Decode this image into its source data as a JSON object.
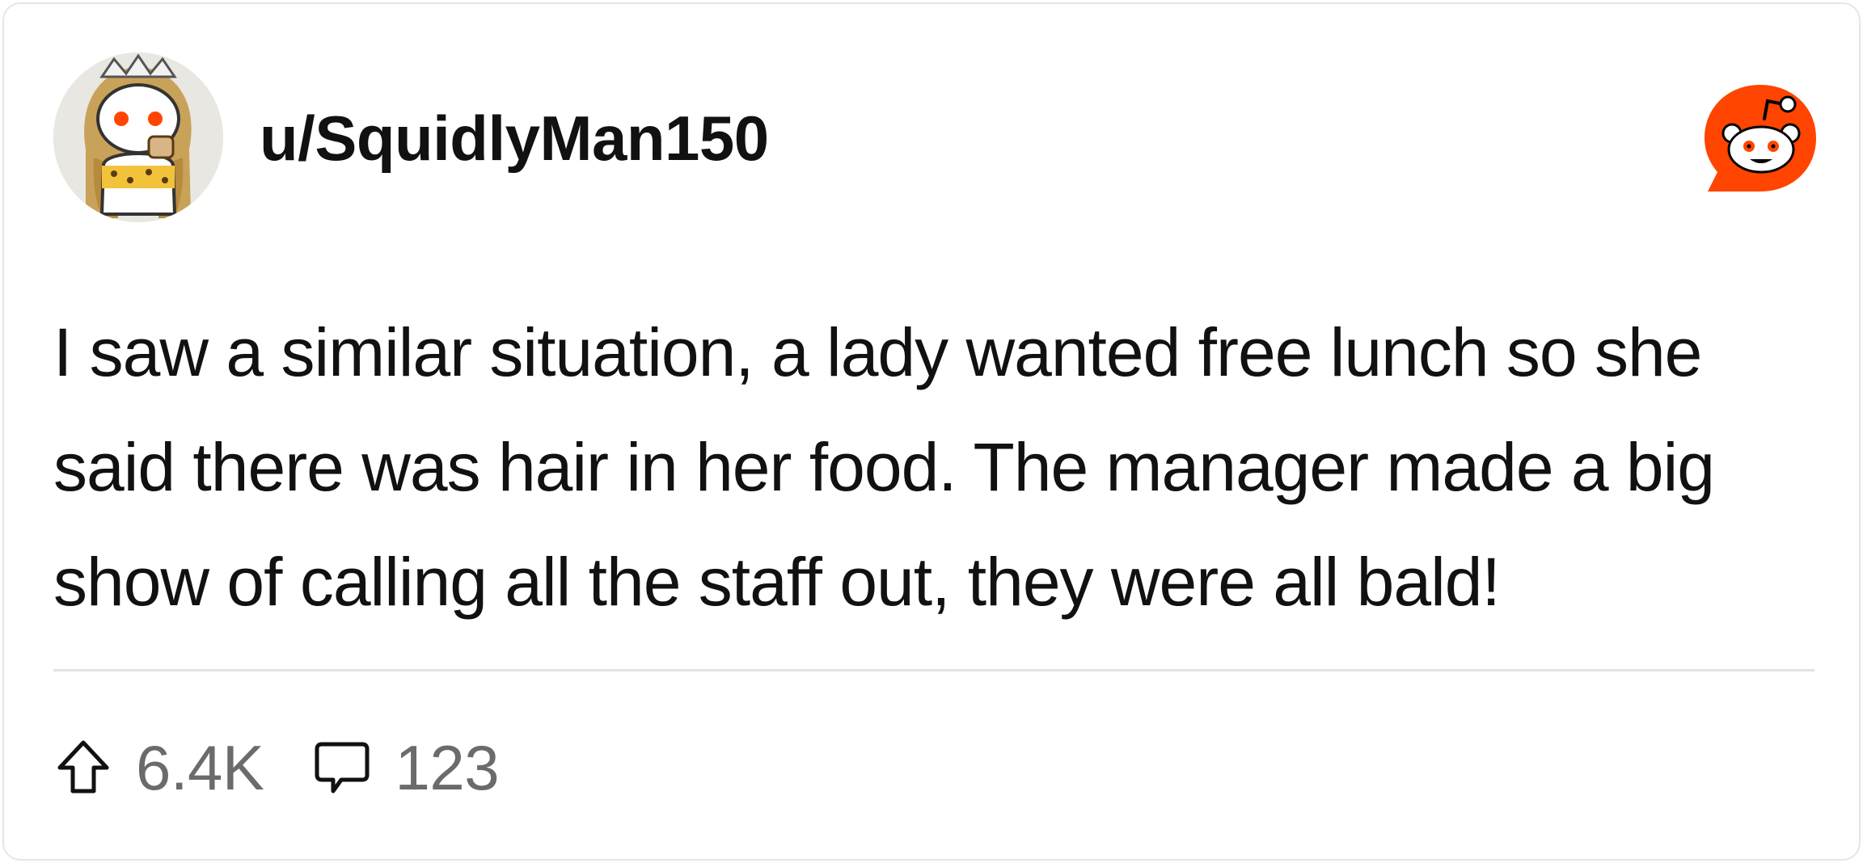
{
  "post": {
    "username": "u/SquidlyMan150",
    "body": "I saw a similar situation, a lady wanted free lunch so she said there was hair in her food. The manager made a big show of calling all the staff out, they were all bald!"
  },
  "stats": {
    "upvotes": "6.4K",
    "comments": "123"
  },
  "icons": {
    "avatar": "snoo-avatar-icon",
    "logo": "reddit-logo-icon",
    "upvote": "upvote-arrow-icon",
    "comment": "comment-bubble-icon"
  },
  "colors": {
    "brand": "#FF4500",
    "text": "#111111",
    "muted": "#6b6b6b",
    "border": "#e6e6e6"
  }
}
